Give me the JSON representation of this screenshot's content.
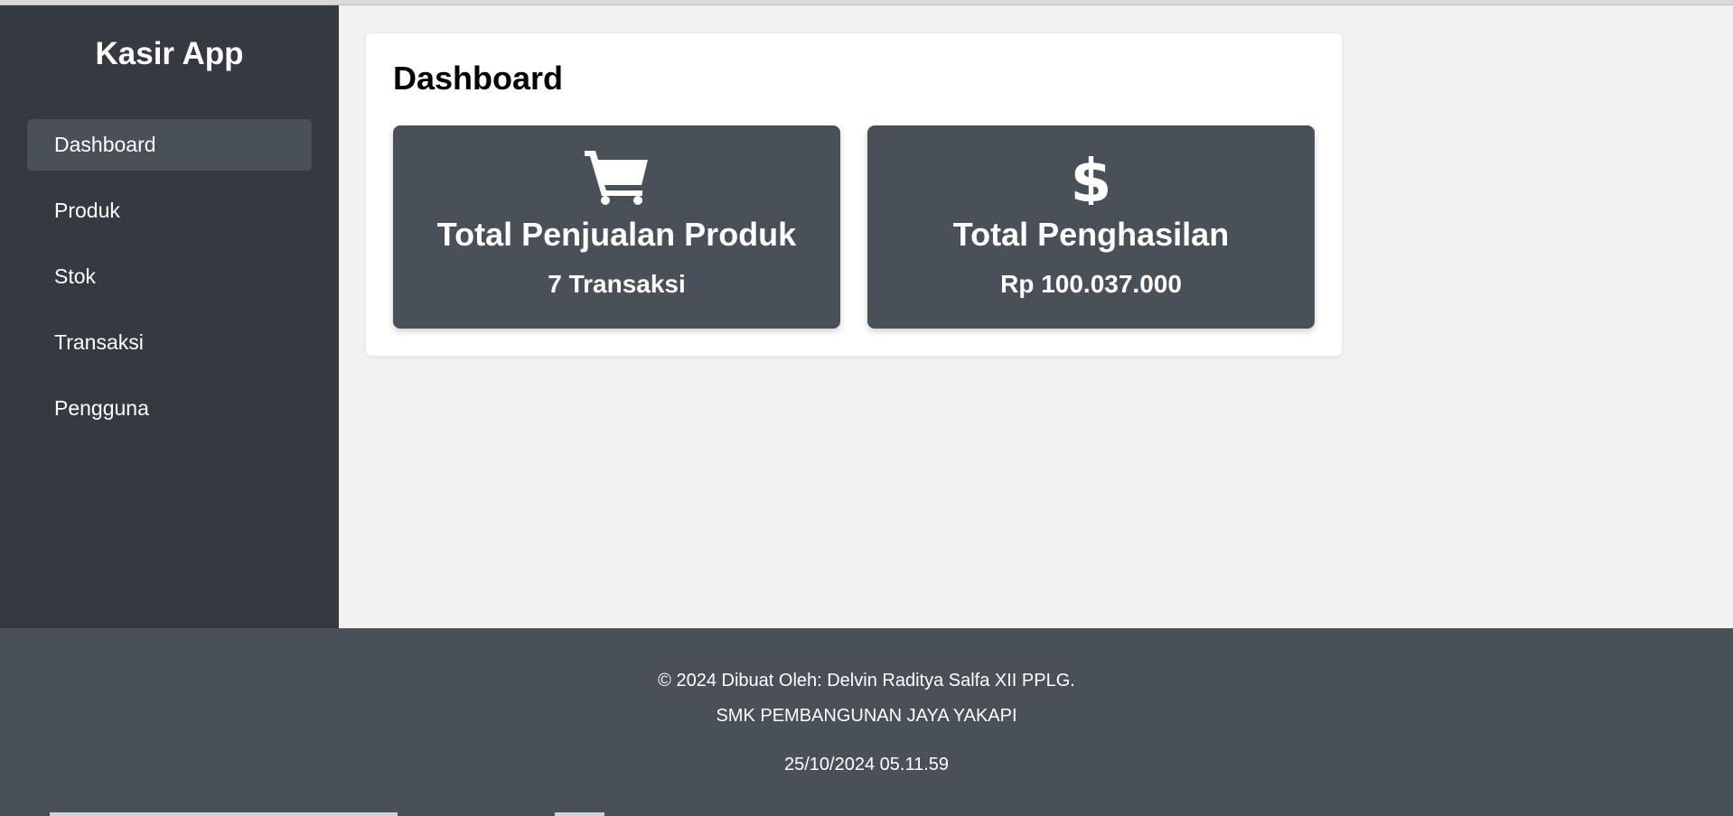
{
  "app": {
    "brand": "Kasir App"
  },
  "sidebar": {
    "items": [
      {
        "label": "Dashboard",
        "active": true
      },
      {
        "label": "Produk",
        "active": false
      },
      {
        "label": "Stok",
        "active": false
      },
      {
        "label": "Transaksi",
        "active": false
      },
      {
        "label": "Pengguna",
        "active": false
      }
    ]
  },
  "main": {
    "title": "Dashboard",
    "cards": [
      {
        "icon": "cart-icon",
        "title": "Total Penjualan Produk",
        "value": "7 Transaksi"
      },
      {
        "icon": "dollar-icon",
        "title": "Total Penghasilan",
        "value": "Rp 100.037.000"
      }
    ]
  },
  "footer": {
    "credit": "© 2024 Dibuat Oleh: Delvin Raditya Salfa XII PPLG.",
    "school": "SMK PEMBANGUNAN JAYA YAKAPI",
    "datetime": "25/10/2024 05.11.59"
  },
  "colors": {
    "sidebar_bg": "#343a40",
    "active_item_bg": "#495057",
    "card_bg": "#495057",
    "footer_bg": "#495057",
    "page_bg": "#f2f2f2"
  }
}
